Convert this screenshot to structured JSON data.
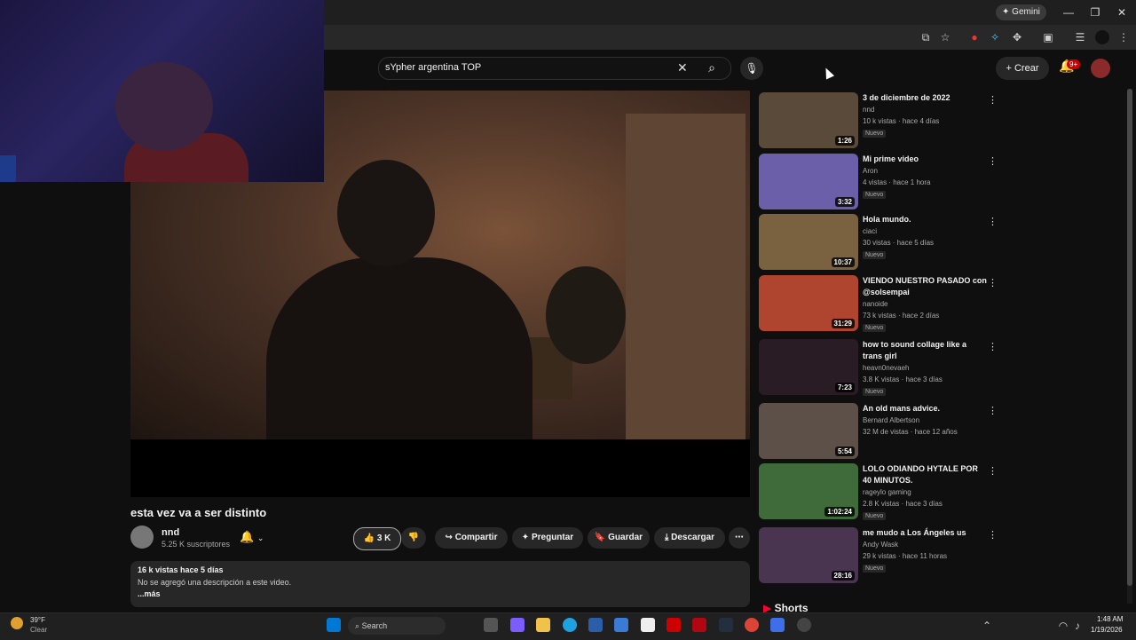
{
  "browser": {
    "gemini_label": "Gemini",
    "window_controls": {
      "minimize": "—",
      "maximize": "❐",
      "close": "✕"
    }
  },
  "search": {
    "value": "sYpher argentina TOP",
    "clear_glyph": "✕",
    "search_glyph": "⌕",
    "mic_glyph": "🎙"
  },
  "header": {
    "create_label": "Crear",
    "create_glyph": "+",
    "notifications_badge": "9+"
  },
  "video": {
    "title": "esta vez va a ser distinto",
    "channel": "nnd",
    "subscribers": "5.25 K suscriptores",
    "likes": "3 K",
    "share_label": "Compartir",
    "ask_label": "Preguntar",
    "save_label": "Guardar",
    "download_label": "Descargar",
    "more_glyph": "⋯"
  },
  "description": {
    "stats": "16 k vistas  hace 5 días",
    "text": "No se agregó una descripción a este video.",
    "more": "...más"
  },
  "recommendations": [
    {
      "title": "3 de diciembre de 2022",
      "channel": "nnd",
      "stats": "10 k vistas · hace 4 días",
      "badge": "Nuevo",
      "duration": "1:26",
      "thumb_color": "#5a4a3a"
    },
    {
      "title": "Mi prime video",
      "channel": "Aron",
      "stats": "4 vistas · hace 1 hora",
      "badge": "Nuevo",
      "duration": "3:32",
      "thumb_color": "#6a5fa8"
    },
    {
      "title": "Hola mundo.",
      "channel": "ciaci",
      "stats": "30 vistas · hace 5 días",
      "badge": "Nuevo",
      "duration": "10:37",
      "thumb_color": "#7a6240"
    },
    {
      "title": "VIENDO NUESTRO PASADO con @solsempai",
      "channel": "nanoide",
      "stats": "73 k vistas · hace 2 días",
      "badge": "Nuevo",
      "duration": "31:29",
      "thumb_color": "#b0452f"
    },
    {
      "title": "how to sound collage like a trans girl",
      "channel": "heavn0nevaeh",
      "stats": "3.8 K vistas · hace 3 días",
      "badge": "Nuevo",
      "duration": "7:23",
      "thumb_color": "#2a1c24"
    },
    {
      "title": "An old mans advice.",
      "channel": "Bernard Albertson",
      "stats": "32 M de vistas · hace 12 años",
      "badge": "",
      "duration": "5:54",
      "thumb_color": "#5d5048"
    },
    {
      "title": "LOLO ODIANDO HYTALE POR 40 MINUTOS.",
      "channel": "rageylo gaming",
      "stats": "2.8 K vistas · hace 3 días",
      "badge": "Nuevo",
      "duration": "1:02:24",
      "thumb_color": "#3f6a3a"
    },
    {
      "title": "me mudo a Los Ángeles us",
      "channel": "Andy Wask",
      "stats": "29 k vistas · hace 11 horas",
      "badge": "Nuevo",
      "duration": "28:16",
      "thumb_color": "#4a3550"
    }
  ],
  "shorts_label": "Shorts",
  "taskbar": {
    "weather_temp": "39°F",
    "weather_condition": "Clear",
    "search_label": "Search",
    "time": "1:48 AM",
    "date": "1/19/2026"
  }
}
